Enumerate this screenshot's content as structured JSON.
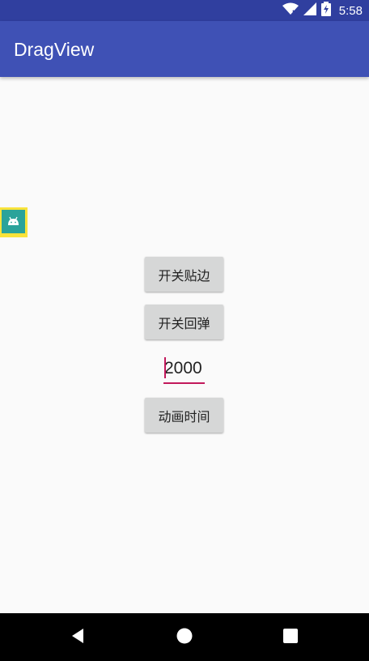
{
  "status_bar": {
    "time": "5:58",
    "icons": [
      "wifi-icon",
      "cell-signal-icon",
      "battery-charging-icon"
    ]
  },
  "app_bar": {
    "title": "DragView",
    "color": "#3f51b5"
  },
  "drag_view": {
    "icon": "android-icon",
    "border_color": "#f9e33a",
    "fill_color": "#2aa39a"
  },
  "buttons": {
    "toggle_edge": "开关贴边",
    "toggle_rebound": "开关回弹",
    "animation_time": "动画时间"
  },
  "duration_input": {
    "value": "2000"
  },
  "nav_bar": {
    "icons": [
      "back-icon",
      "home-icon",
      "recents-icon"
    ]
  }
}
